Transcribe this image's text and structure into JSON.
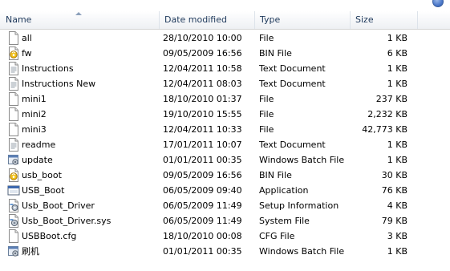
{
  "columns": {
    "name": "Name",
    "date_modified": "Date modified",
    "type": "Type",
    "size": "Size"
  },
  "icons": {
    "file": "generic-file-icon",
    "bin": "bin-file-icon",
    "text": "text-document-icon",
    "bat": "batch-file-icon",
    "app": "application-icon",
    "inf": "setup-information-icon",
    "sys": "system-file-icon",
    "top": "help-icon"
  },
  "files": [
    {
      "name": "all",
      "date": "28/10/2010 10:00",
      "type": "File",
      "size": "1 KB",
      "icon": "file"
    },
    {
      "name": "fw",
      "date": "09/05/2009 16:56",
      "type": "BIN File",
      "size": "6 KB",
      "icon": "bin"
    },
    {
      "name": "Instructions",
      "date": "12/04/2011 10:58",
      "type": "Text Document",
      "size": "1 KB",
      "icon": "text"
    },
    {
      "name": "Instructions New",
      "date": "12/04/2011 08:03",
      "type": "Text Document",
      "size": "1 KB",
      "icon": "text"
    },
    {
      "name": "mini1",
      "date": "18/10/2010 01:37",
      "type": "File",
      "size": "237 KB",
      "icon": "file"
    },
    {
      "name": "mini2",
      "date": "19/10/2010 15:55",
      "type": "File",
      "size": "2,232 KB",
      "icon": "file"
    },
    {
      "name": "mini3",
      "date": "12/04/2011 10:33",
      "type": "File",
      "size": "42,773 KB",
      "icon": "file"
    },
    {
      "name": "readme",
      "date": "17/01/2011 10:07",
      "type": "Text Document",
      "size": "1 KB",
      "icon": "text"
    },
    {
      "name": "update",
      "date": "01/01/2011 00:35",
      "type": "Windows Batch File",
      "size": "1 KB",
      "icon": "bat"
    },
    {
      "name": "usb_boot",
      "date": "09/05/2009 16:56",
      "type": "BIN File",
      "size": "30 KB",
      "icon": "bin"
    },
    {
      "name": "USB_Boot",
      "date": "06/05/2009 09:40",
      "type": "Application",
      "size": "76 KB",
      "icon": "app"
    },
    {
      "name": "Usb_Boot_Driver",
      "date": "06/05/2009 11:49",
      "type": "Setup Information",
      "size": "4 KB",
      "icon": "inf"
    },
    {
      "name": "Usb_Boot_Driver.sys",
      "date": "06/05/2009 11:49",
      "type": "System File",
      "size": "79 KB",
      "icon": "sys"
    },
    {
      "name": "USBBoot.cfg",
      "date": "18/10/2010 00:08",
      "type": "CFG File",
      "size": "3 KB",
      "icon": "file"
    },
    {
      "name": "刷机",
      "date": "01/01/2011 00:35",
      "type": "Windows Batch File",
      "size": "1 KB",
      "icon": "bat"
    }
  ]
}
